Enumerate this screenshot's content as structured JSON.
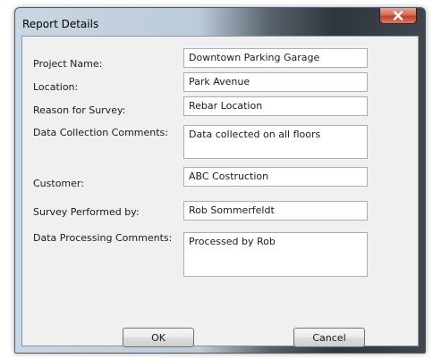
{
  "dialog": {
    "title": "Report Details"
  },
  "form": {
    "project_name": {
      "label": "Project Name:",
      "value": "Downtown Parking Garage"
    },
    "location": {
      "label": "Location:",
      "value": "Park Avenue"
    },
    "reason": {
      "label": "Reason for Survey:",
      "value": "Rebar Location"
    },
    "data_collection_comments": {
      "label": "Data Collection Comments:",
      "value": "Data collected on all floors"
    },
    "customer": {
      "label": "Customer:",
      "value": "ABC Costruction"
    },
    "performed_by": {
      "label": "Survey Performed by:",
      "value": "Rob Sommerfeldt"
    },
    "data_processing_comments": {
      "label": "Data Processing Comments:",
      "value": "Processed by Rob"
    }
  },
  "buttons": {
    "ok_label": "OK",
    "cancel_label": "Cancel"
  },
  "icons": {
    "close": "close-icon"
  },
  "colors": {
    "close_button": "#c9452e",
    "client_background": "#f0f0f0"
  }
}
